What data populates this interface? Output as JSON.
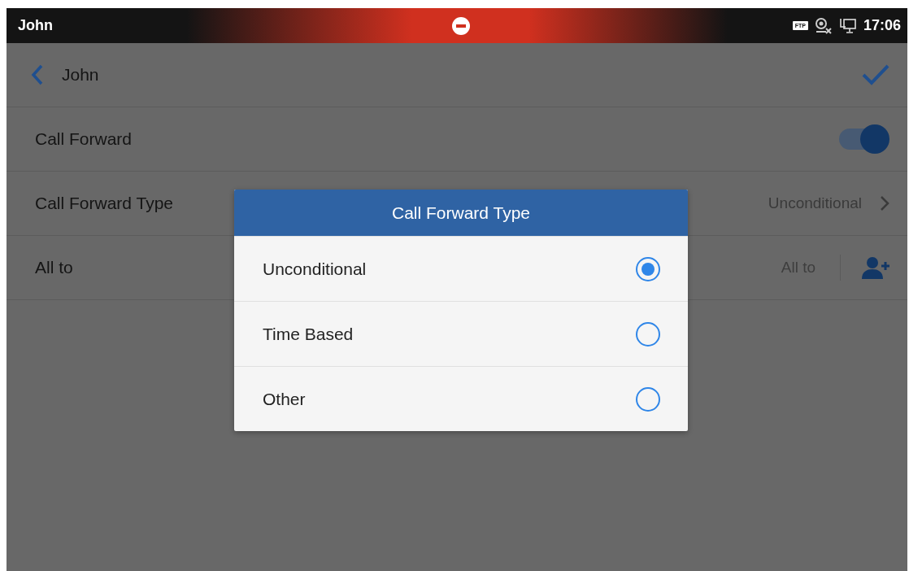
{
  "status_bar": {
    "user": "John",
    "ftp_badge": "FTP",
    "time": "17:06"
  },
  "header": {
    "title": "John"
  },
  "rows": [
    {
      "kind": "toggle",
      "label": "Call Forward",
      "on": true
    },
    {
      "kind": "value",
      "label": "Call Forward Type",
      "value": "Unconditional"
    },
    {
      "kind": "contact",
      "label": "All to",
      "placeholder": "All to"
    }
  ],
  "dialog": {
    "title": "Call Forward Type",
    "options": [
      {
        "label": "Unconditional",
        "selected": true
      },
      {
        "label": "Time Based",
        "selected": false
      },
      {
        "label": "Other",
        "selected": false
      }
    ]
  }
}
